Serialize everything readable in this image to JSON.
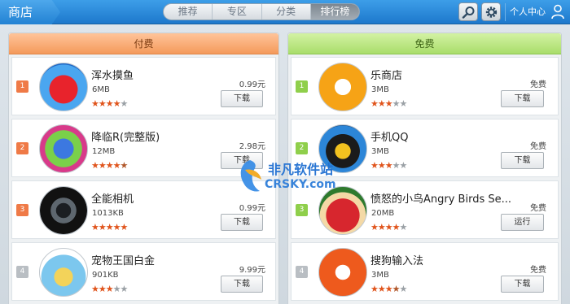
{
  "topbar": {
    "title": "商店",
    "tabs": [
      {
        "label": "推荐",
        "active": false
      },
      {
        "label": "专区",
        "active": false
      },
      {
        "label": "分类",
        "active": false
      },
      {
        "label": "排行榜",
        "active": true
      }
    ],
    "search_icon": "search-icon",
    "settings_icon": "gear-icon",
    "personal_label": "个人中心",
    "person_icon": "person-icon"
  },
  "paid": {
    "header": "付费",
    "items": [
      {
        "rank": "1",
        "name": "浑水摸鱼",
        "size": "6MB",
        "rating": 4,
        "price": "0.99元",
        "button": "下载"
      },
      {
        "rank": "2",
        "name": "降临R(完整版)",
        "size": "12MB",
        "rating": 4.5,
        "price": "2.98元",
        "button": "下载"
      },
      {
        "rank": "3",
        "name": "全能相机",
        "size": "1013KB",
        "rating": 5,
        "price": "0.99元",
        "button": "下载"
      },
      {
        "rank": "4",
        "name": "宠物王国白金",
        "size": "901KB",
        "rating": 3,
        "price": "9.99元",
        "button": "下载"
      }
    ]
  },
  "free": {
    "header": "免费",
    "items": [
      {
        "rank": "1",
        "name": "乐商店",
        "size": "3MB",
        "rating": 3,
        "price": "免费",
        "button": "下载"
      },
      {
        "rank": "2",
        "name": "手机QQ",
        "size": "3MB",
        "rating": 3,
        "price": "免费",
        "button": "下载"
      },
      {
        "rank": "3",
        "name": "愤怒的小鸟Angry Birds Se...",
        "size": "20MB",
        "rating": 4,
        "price": "免费",
        "button": "运行"
      },
      {
        "rank": "4",
        "name": "搜狗输入法",
        "size": "3MB",
        "rating": 3.5,
        "price": "免费",
        "button": "下载"
      }
    ]
  },
  "watermark": {
    "cn": "非凡软件站",
    "en": "CRSKY.com"
  },
  "colors": {
    "topbar": "#2282d3",
    "paid_header": "#f49a5b",
    "free_header": "#a9dd6a",
    "star": "#e0541c"
  }
}
